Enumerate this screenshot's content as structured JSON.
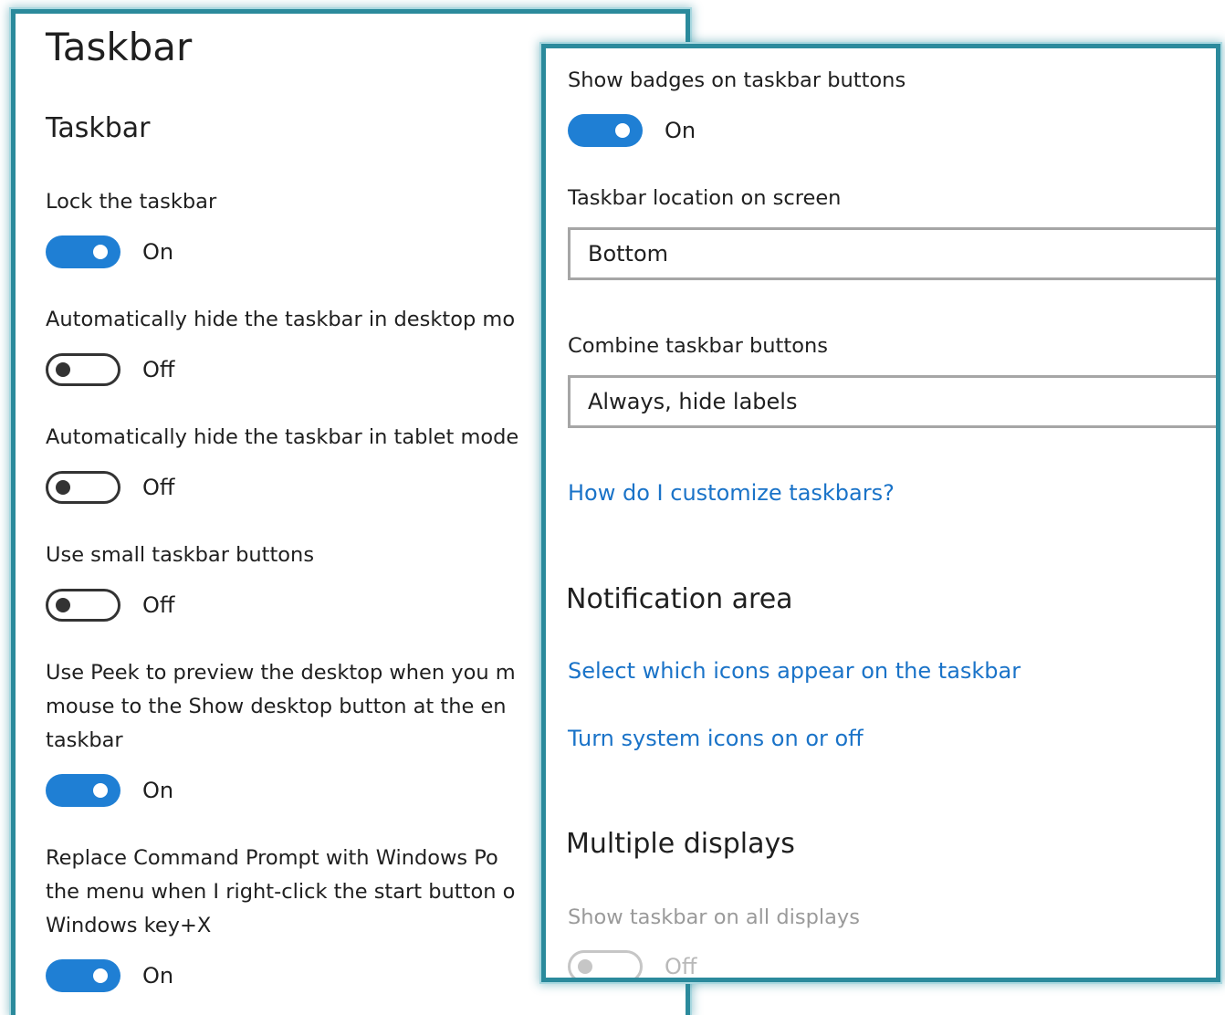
{
  "left": {
    "page_title": "Taskbar",
    "section_title": "Taskbar",
    "settings": [
      {
        "label_lines": [
          "Lock the taskbar"
        ],
        "state": "On"
      },
      {
        "label_lines": [
          "Automatically hide the taskbar in desktop mo"
        ],
        "state": "Off"
      },
      {
        "label_lines": [
          "Automatically hide the taskbar in tablet mode"
        ],
        "state": "Off"
      },
      {
        "label_lines": [
          "Use small taskbar buttons"
        ],
        "state": "Off"
      },
      {
        "label_lines": [
          "Use Peek to preview the desktop when you m",
          "mouse to the Show desktop button at the en",
          "taskbar"
        ],
        "state": "On"
      },
      {
        "label_lines": [
          "Replace Command Prompt with Windows Po",
          "the menu when I right-click the start button o",
          "Windows key+X"
        ],
        "state": "On"
      }
    ]
  },
  "right": {
    "badges": {
      "label": "Show badges on taskbar buttons",
      "state": "On"
    },
    "location": {
      "label": "Taskbar location on screen",
      "value": "Bottom"
    },
    "combine": {
      "label": "Combine taskbar buttons",
      "value": "Always, hide labels"
    },
    "help_link": "How do I customize taskbars?",
    "notification": {
      "title": "Notification area",
      "link1": "Select which icons appear on the taskbar",
      "link2": "Turn system icons on or off"
    },
    "multiple": {
      "title": "Multiple displays",
      "label": "Show taskbar on all displays",
      "state": "Off"
    }
  },
  "colors": {
    "accent": "#1f7fd4",
    "link": "#1a73c8",
    "frame": "#2b8a9c"
  }
}
